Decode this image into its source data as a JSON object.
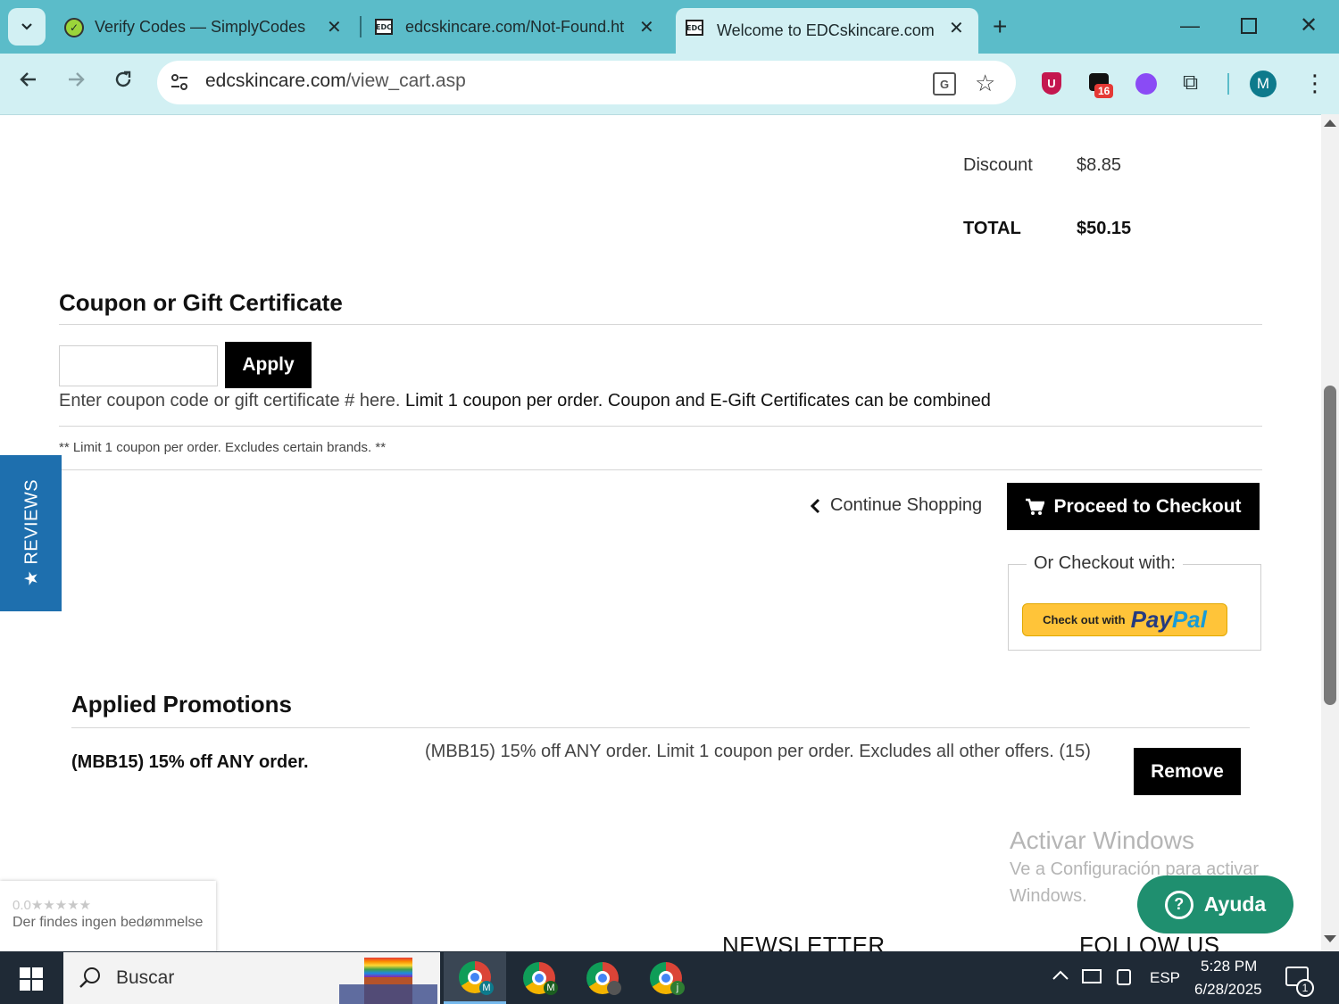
{
  "browser": {
    "tabs": [
      {
        "title": "Verify Codes — SimplyCodes",
        "active": false
      },
      {
        "title": "edcskincare.com/Not-Found.ht",
        "active": false
      },
      {
        "title": "Welcome to EDCskincare.com -",
        "active": true
      }
    ],
    "favicon_text": "EDC",
    "url_domain": "edcskincare.com",
    "url_path": "/view_cart.asp",
    "extension_badge": "16",
    "profile_initial": "M"
  },
  "totals": {
    "discount_label": "Discount",
    "discount_value": "$8.85",
    "total_label": "TOTAL",
    "total_value": "$50.15"
  },
  "coupon": {
    "heading": "Coupon or Gift Certificate",
    "input_value": "",
    "apply_label": "Apply",
    "help_text": "Enter coupon code or gift certificate # here.",
    "help_text_bold": "Limit 1 coupon per order. Coupon and E-Gift Certificates can be combined",
    "note": "** Limit 1 coupon per order. Excludes certain brands. **"
  },
  "checkout": {
    "continue_label": "Continue Shopping",
    "proceed_label": "Proceed to Checkout",
    "or_checkout_with": "Or Checkout with:",
    "paypal_prefix": "Check out with",
    "paypal_logo_a": "Pay",
    "paypal_logo_b": "Pal"
  },
  "reviews_tab_label": "★ REVIEWS",
  "promotions": {
    "heading": "Applied Promotions",
    "items": [
      {
        "name": "(MBB15) 15% off ANY order.",
        "description": "(MBB15) 15% off ANY order. Limit 1 coupon per order. Excludes all other offers. (15)",
        "remove_label": "Remove"
      }
    ]
  },
  "trust_badge": {
    "rating": "0.0",
    "stars": "★★★★★",
    "text": "Der findes ingen bedømmelse"
  },
  "windows_watermark": {
    "title": "Activar Windows",
    "line1": "Ve a Configuración para activar",
    "line2": "Windows."
  },
  "help_button_label": "Ayuda",
  "footer": {
    "newsletter": "NEWSLETTER",
    "follow_us": "FOLLOW US"
  },
  "taskbar": {
    "search_placeholder": "Buscar",
    "language": "ESP",
    "time": "5:28 PM",
    "date": "6/28/2025",
    "notification_count": "1",
    "chrome_profile_letters": [
      "M",
      "M",
      "",
      "j"
    ]
  },
  "colors": {
    "tabbar": "#5bbcc9",
    "toolbar": "#d2f0f3",
    "reviews_blue": "#1e6fae",
    "help_green": "#1f8f6f",
    "paypal_yellow": "#ffc439"
  }
}
